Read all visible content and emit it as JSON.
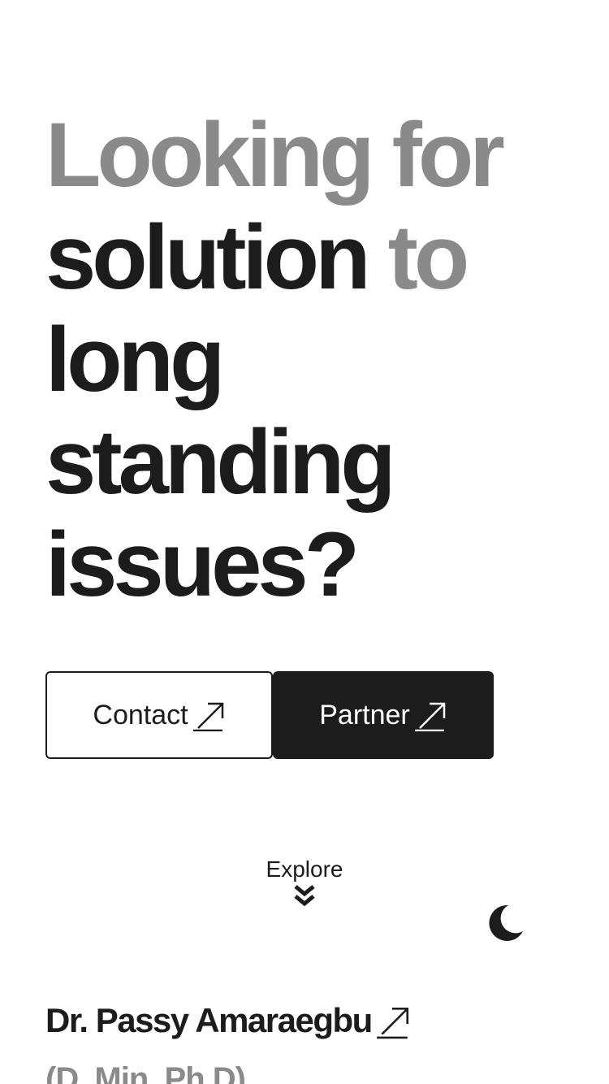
{
  "hero": {
    "line1": "Looking for",
    "line2_word1": "solution",
    "line2_word2": "to",
    "line3": "long",
    "line4": "standing",
    "line5": "issues?"
  },
  "actions": {
    "contact_label": "Contact",
    "partner_label": "Partner"
  },
  "explore": {
    "label": "Explore"
  },
  "profile": {
    "name": "Dr. Passy Amaraegbu",
    "credentials": "(D. Min, Ph.D)"
  },
  "icons": {
    "button_arrow": "arrow-up-right-icon",
    "explore": "double-chevron-down-icon",
    "theme_toggle": "moon-icon"
  },
  "colors": {
    "text": "#1c1c1c",
    "muted": "#8a8a8a",
    "background": "#ffffff"
  }
}
